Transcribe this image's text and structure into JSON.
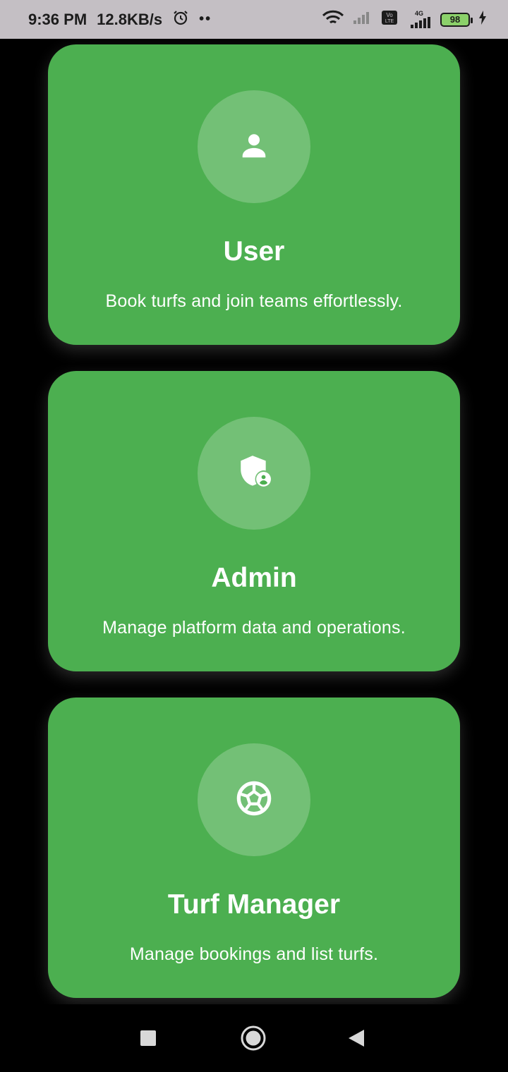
{
  "status_bar": {
    "time": "9:36 PM",
    "speed": "12.8KB/s",
    "battery": "98",
    "network": "4G"
  },
  "roles": [
    {
      "title": "User",
      "description": "Book turfs and join teams effortlessly.",
      "icon": "person-icon"
    },
    {
      "title": "Admin",
      "description": "Manage platform data and operations.",
      "icon": "admin-shield-icon"
    },
    {
      "title": "Turf Manager",
      "description": "Manage bookings and list turfs.",
      "icon": "soccer-ball-icon"
    }
  ],
  "colors": {
    "card": "#4caf50",
    "status_bar": "#c4bfc4",
    "background": "#000000"
  }
}
